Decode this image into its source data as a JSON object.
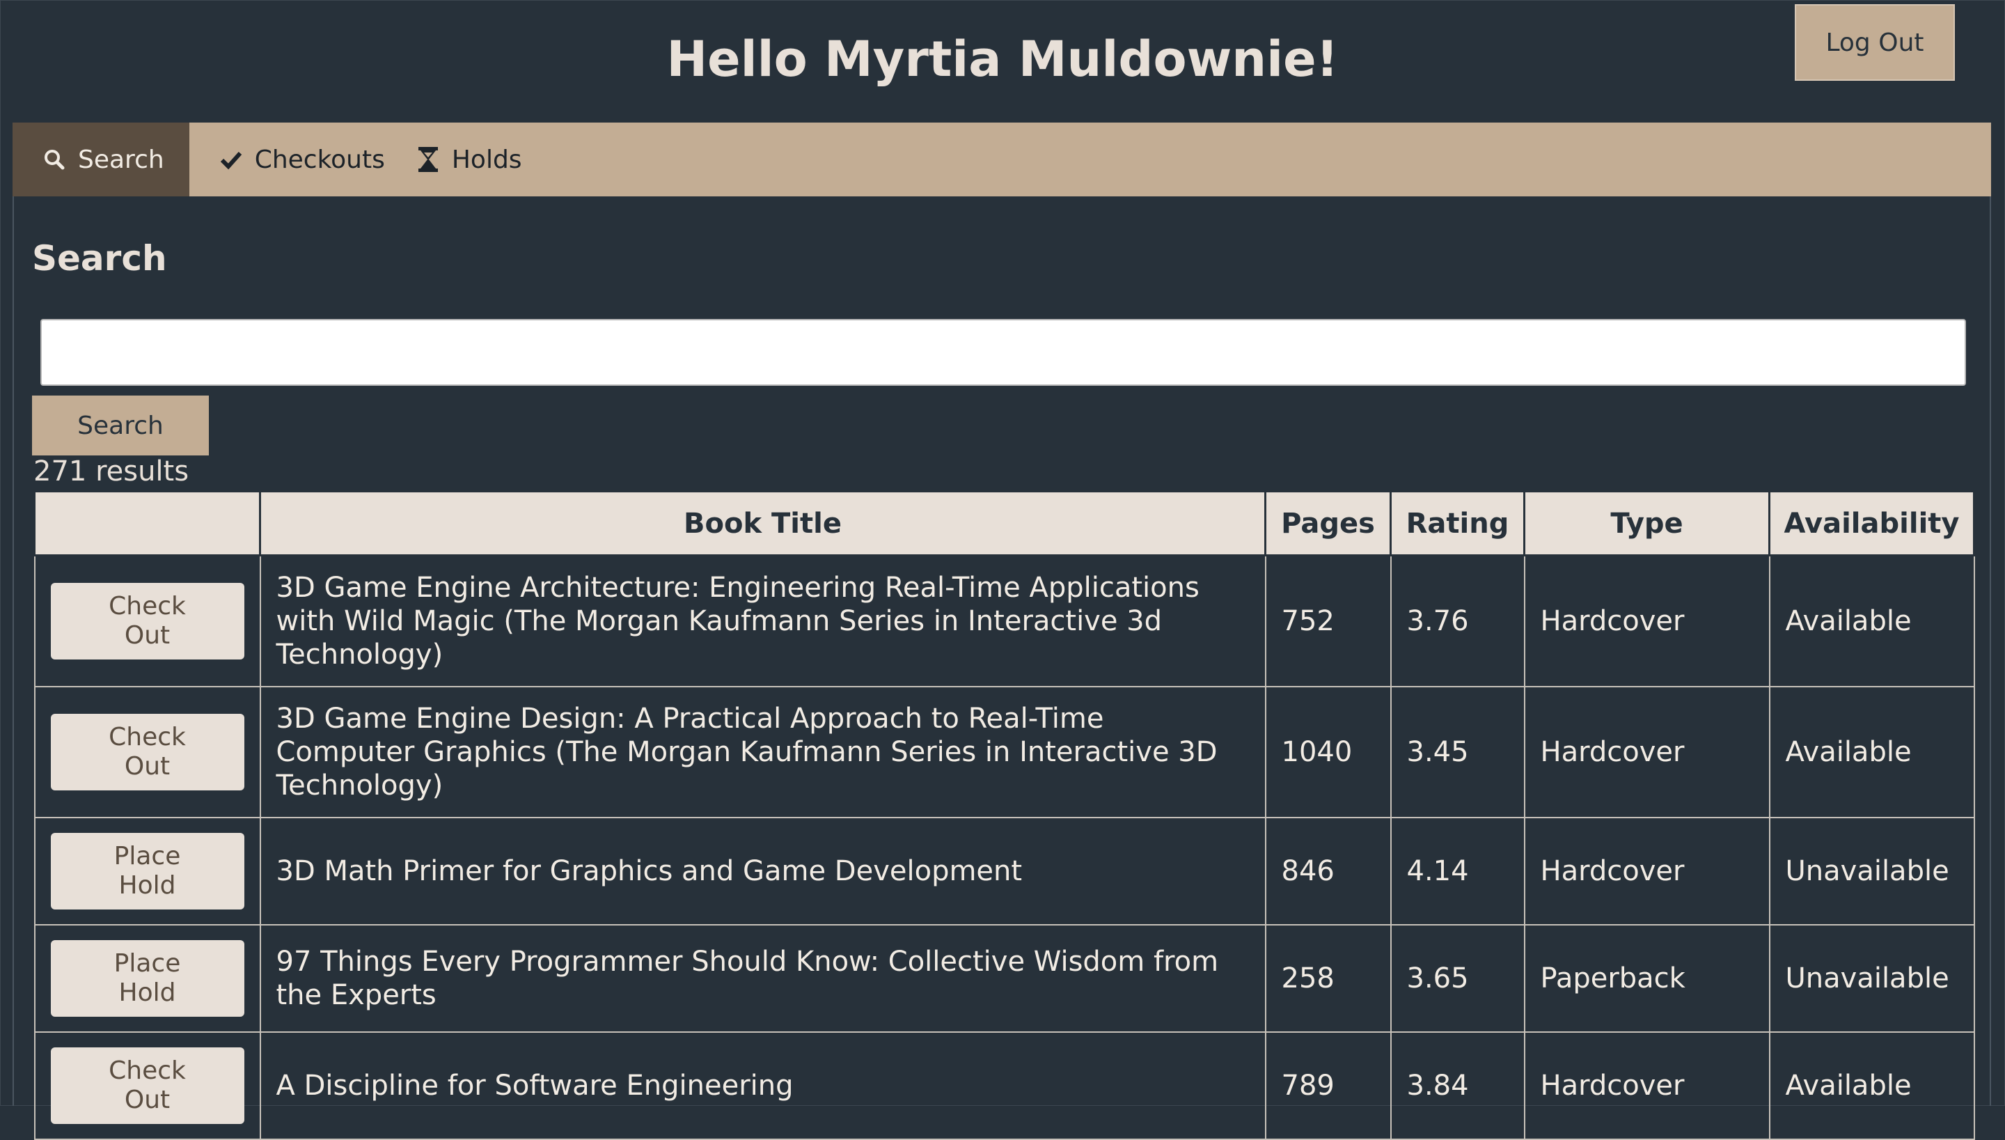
{
  "header": {
    "greeting": "Hello Myrtia Muldownie!",
    "logout_label": "Log Out"
  },
  "nav": {
    "tabs": [
      {
        "label": "Search",
        "icon": "search-icon",
        "active": true
      },
      {
        "label": "Checkouts",
        "icon": "checkmark-icon",
        "active": false
      },
      {
        "label": "Holds",
        "icon": "hourglass-icon",
        "active": false
      }
    ]
  },
  "search": {
    "title": "Search",
    "input_value": "",
    "button_label": "Search",
    "results_count": "271 results"
  },
  "table": {
    "columns": [
      "",
      "Book Title",
      "Pages",
      "Rating",
      "Type",
      "Availability"
    ],
    "rows": [
      {
        "action": "Check Out",
        "title": "3D Game Engine Architecture: Engineering Real-Time Applications with Wild Magic (The Morgan Kaufmann Series in Interactive 3d Technology)",
        "pages": "752",
        "rating": "3.76",
        "type": "Hardcover",
        "availability": "Available"
      },
      {
        "action": "Check Out",
        "title": "3D Game Engine Design: A Practical Approach to Real-Time Computer Graphics (The Morgan Kaufmann Series in Interactive 3D Technology)",
        "pages": "1040",
        "rating": "3.45",
        "type": "Hardcover",
        "availability": "Available"
      },
      {
        "action": "Place Hold",
        "title": "3D Math Primer for Graphics and Game Development",
        "pages": "846",
        "rating": "4.14",
        "type": "Hardcover",
        "availability": "Unavailable"
      },
      {
        "action": "Place Hold",
        "title": "97 Things Every Programmer Should Know: Collective Wisdom from the Experts",
        "pages": "258",
        "rating": "3.65",
        "type": "Paperback",
        "availability": "Unavailable"
      },
      {
        "action": "Check Out",
        "title": "A Discipline for Software Engineering",
        "pages": "789",
        "rating": "3.84",
        "type": "Hardcover",
        "availability": "Available"
      }
    ]
  },
  "colors": {
    "background": "#27313a",
    "accent": "#c3ad94",
    "active_tab": "#5a4d40",
    "light": "#e8e0d8"
  }
}
